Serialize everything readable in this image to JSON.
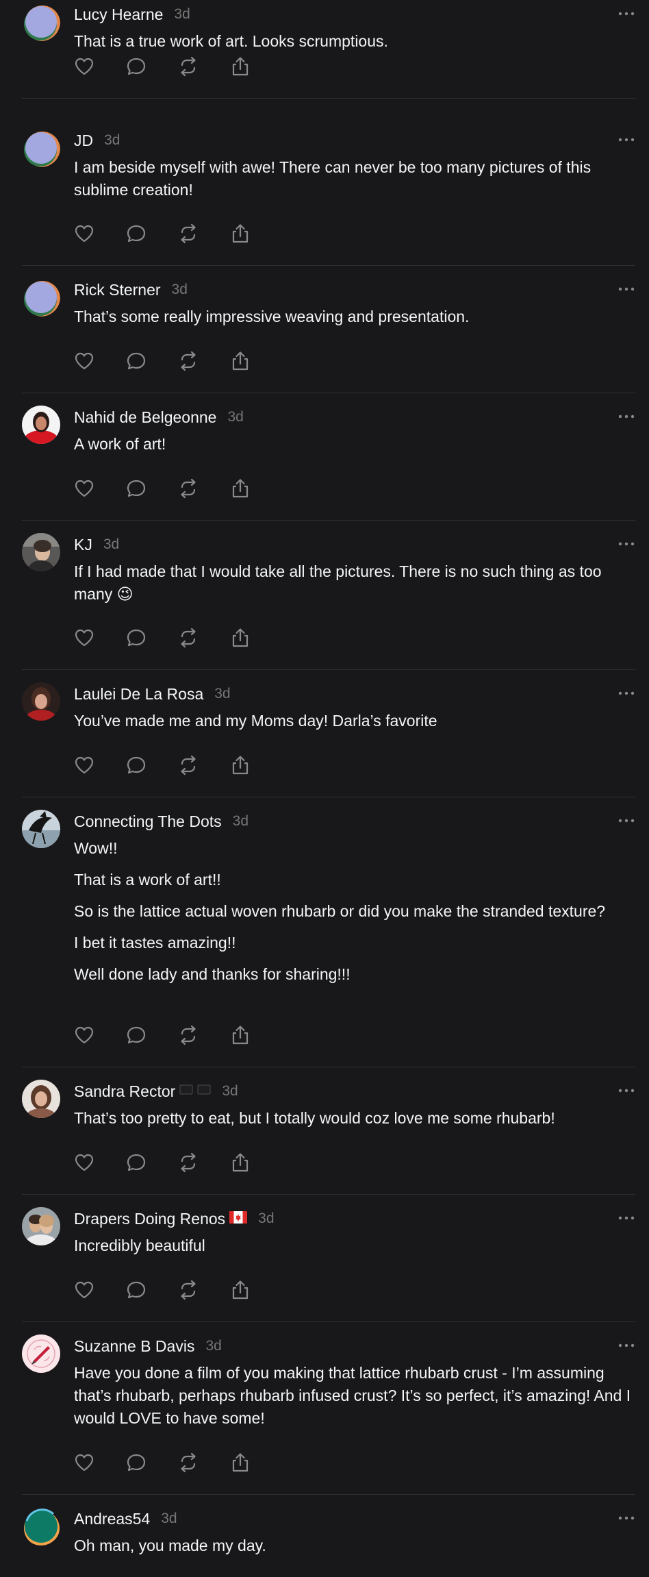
{
  "colors": {
    "background": "#18181a",
    "text_primary": "#f3f5f7",
    "text_secondary": "#777777",
    "divider": "#2e2e31",
    "icon": "#8a8a8e"
  },
  "action_icons": [
    "heart-icon",
    "comment-icon",
    "repost-icon",
    "share-icon"
  ],
  "replies": [
    {
      "username": "Lucy Hearne",
      "time": "3d",
      "avatar": "default-avatar",
      "paragraphs": [
        "That is a true work of art. Looks scrumptious."
      ]
    },
    {
      "username": "JD",
      "time": "3d",
      "avatar": "default-avatar",
      "paragraphs": [
        "I am beside myself with awe! There can never be too many pictures of this sublime creation!"
      ]
    },
    {
      "username": "Rick Sterner",
      "time": "3d",
      "avatar": "default-avatar",
      "paragraphs": [
        "That’s some really impressive weaving and presentation."
      ]
    },
    {
      "username": "Nahid de Belgeonne",
      "time": "3d",
      "avatar": "photo-red-avatar",
      "paragraphs": [
        "A work of art!"
      ]
    },
    {
      "username": "KJ",
      "time": "3d",
      "avatar": "photo-grey-avatar",
      "paragraphs": [
        "If I had made that I would take all the pictures. There is no such thing as too many 😉"
      ]
    },
    {
      "username": "Laulei De La Rosa",
      "time": "3d",
      "avatar": "photo-dark-avatar",
      "paragraphs": [
        "You’ve made me and my Moms day! Darla’s favorite"
      ]
    },
    {
      "username": "Connecting The Dots",
      "time": "3d",
      "avatar": "photo-bird-avatar",
      "paragraphs": [
        "Wow!!",
        "That is a work of art!!",
        "So is the lattice actual woven rhubarb or did you make the stranded texture?",
        "I bet it tastes amazing!!",
        "Well done lady and thanks for sharing!!!"
      ]
    },
    {
      "username": "Sandra Rector",
      "time": "3d",
      "avatar": "photo-brown-avatar",
      "flags": [
        "black-flag-icon",
        "black-flag-icon"
      ],
      "paragraphs": [
        "That’s too pretty to eat, but I totally would coz love me some rhubarb!"
      ]
    },
    {
      "username": "Drapers Doing Renos",
      "time": "3d",
      "avatar": "photo-couple-avatar",
      "flags": [
        "canada-flag-icon"
      ],
      "paragraphs": [
        "Incredibly beautiful"
      ]
    },
    {
      "username": "Suzanne B Davis",
      "time": "3d",
      "avatar": "pink-logo-avatar",
      "paragraphs": [
        "Have you done a film of you making that lattice rhubarb crust - I’m assuming that’s rhubarb, perhaps rhubarb infused crust? It’s so perfect, it’s amazing! And I would LOVE to have some!"
      ]
    },
    {
      "username": "Andreas54",
      "time": "3d",
      "avatar": "teal-orange-avatar",
      "paragraphs": [
        "Oh man, you made my day."
      ]
    }
  ]
}
